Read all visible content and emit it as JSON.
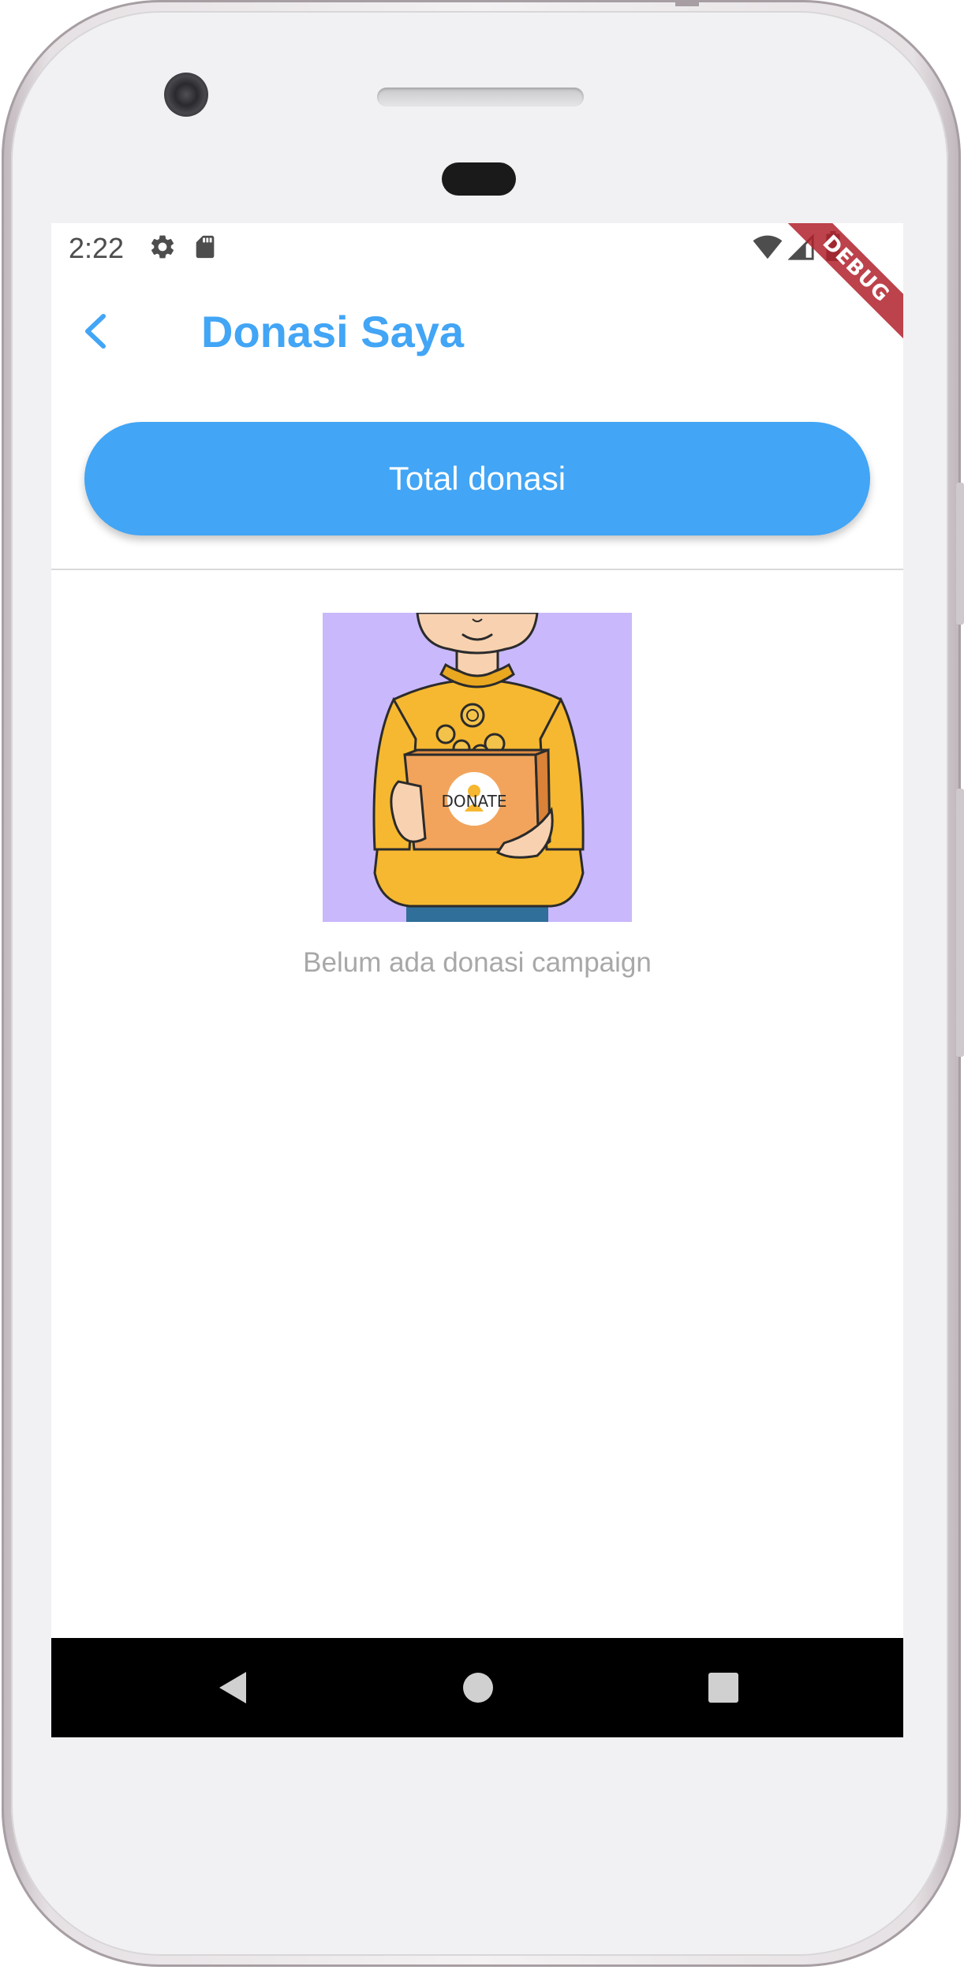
{
  "status_bar": {
    "time": "2:22",
    "left_icons": [
      "settings-icon",
      "sd-card-icon"
    ],
    "right_icons": [
      "wifi-icon",
      "signal-icon",
      "battery-icon"
    ]
  },
  "debug_banner": "DEBUG",
  "app_bar": {
    "back_icon": "chevron-left-icon",
    "title": "Donasi Saya"
  },
  "total_button": {
    "label": "Total donasi"
  },
  "empty_state": {
    "illustration_label": "DONATE",
    "message": "Belum ada donasi campaign"
  },
  "nav_bar": {
    "buttons": [
      "back-triangle-icon",
      "home-circle-icon",
      "recents-square-icon"
    ]
  },
  "colors": {
    "accent": "#42a5f5",
    "illustration_bg": "#c9b8fb",
    "muted_text": "#a8a8a8",
    "debug_banner": "#b0212c"
  }
}
